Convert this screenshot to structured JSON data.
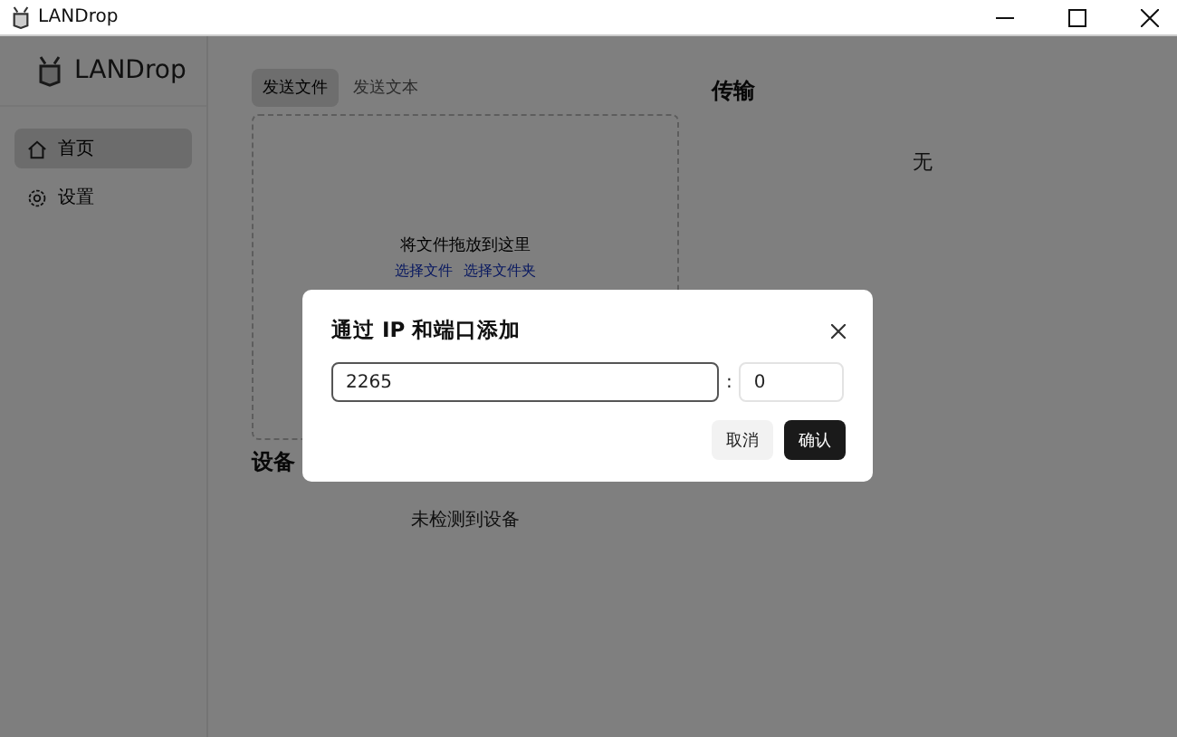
{
  "window": {
    "title": "LANDrop"
  },
  "sidebar": {
    "brand": "LANDrop",
    "items": [
      {
        "label": "首页",
        "selected": true
      },
      {
        "label": "设置",
        "selected": false
      }
    ]
  },
  "send": {
    "tabs": [
      {
        "label": "发送文件",
        "selected": true
      },
      {
        "label": "发送文本",
        "selected": false
      }
    ],
    "drop_hint": "将文件拖放到这里",
    "links": [
      "选择文件",
      "选择文件夹"
    ]
  },
  "transfers": {
    "title": "传输",
    "empty": "无"
  },
  "devices": {
    "title": "设备",
    "empty": "未检测到设备"
  },
  "dialog": {
    "title": "通过 IP 和端口添加",
    "ip_value": "2265",
    "separator": ":",
    "port_value": "0",
    "buttons": [
      {
        "label": "取消",
        "kind": "secondary"
      },
      {
        "label": "确认",
        "kind": "primary"
      }
    ]
  }
}
